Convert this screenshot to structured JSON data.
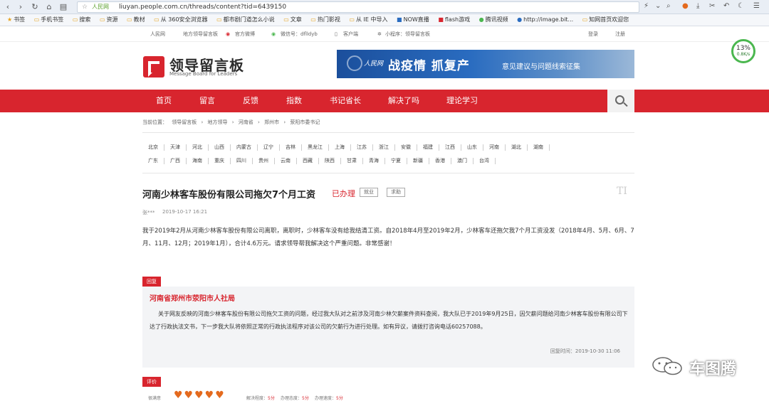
{
  "browser": {
    "url": "liuyan.people.com.cn/threads/content?tid=6439150",
    "secure_label": "人民网",
    "bookmarks": [
      "书签",
      "手机书签",
      "搜索",
      "资源",
      "教材",
      "从 360安全浏览器",
      "都市剧门道怎么小说",
      "文章",
      "热门影视",
      "从 IE 中导入",
      "NOW直播",
      "flash游戏",
      "腾讯视频",
      "http://image.bit...",
      "知网首页欢迎您"
    ]
  },
  "topstrip": {
    "site": "人民网",
    "board": "地方领导留言板",
    "weibo": "官方微博",
    "wechat": "微信号：dflldyb",
    "app": "客户端",
    "mini": "小程序：领导留言板",
    "login": "登录",
    "register": "注册"
  },
  "logo": {
    "title": "领导留言板",
    "subtitle": "Message Board for Leaders"
  },
  "banner": {
    "brand": "人民网",
    "headline": "战疫情 抓复产",
    "sub": "意见建议与问题线索征集"
  },
  "speed": {
    "value": "13%",
    "sub": "0.8K/s"
  },
  "nav": [
    "首页",
    "留言",
    "反馈",
    "指数",
    "书记省长",
    "解决了吗",
    "理论学习"
  ],
  "breadcrumb": [
    "当前位置：",
    "领导留言板",
    "›",
    "地方领导",
    "›",
    "河南省",
    "›",
    "郑州市",
    "›",
    "荥阳市委书记"
  ],
  "provinces_row1": [
    "北京",
    "天津",
    "河北",
    "山西",
    "内蒙古",
    "辽宁",
    "吉林",
    "黑龙江",
    "上海",
    "江苏",
    "浙江",
    "安徽",
    "福建",
    "江西",
    "山东",
    "河南",
    "湖北",
    "湖南"
  ],
  "provinces_row2": [
    "广东",
    "广西",
    "海南",
    "重庆",
    "四川",
    "贵州",
    "云南",
    "西藏",
    "陕西",
    "甘肃",
    "青海",
    "宁夏",
    "新疆",
    "香港",
    "澳门",
    "台湾"
  ],
  "post": {
    "title": "河南少林客车股份有限公司拖欠7个月工资",
    "status": "已办理",
    "tags": [
      "就业",
      "求助"
    ],
    "author": "张***",
    "time": "2019-10-17 16:21",
    "body": "我于2019年2月从河南少林客车股份有限公司离职，离职时，少林客车没有给我结清工资。自2018年4月至2019年2月，少林客车还拖欠我7个月工资没发（2018年4月、5月、6月、7月、11月、12月；2019年1月），合计4.6万元。请求领导帮我解决这个严重问题。非常感谢！"
  },
  "reply": {
    "label": "回复",
    "org": "河南省郑州市荥阳市人社局",
    "text": "关于网友反映的河南少林客车股份有限公司拖欠工资的问题，经过我大队对之前涉及河南少林欠薪案件资料查阅，我大队已于2019年9月25日，因欠薪问题给河南少林客车股份有限公司下达了行政执法文书，下一步我大队将依照正常的行政执法程序对该公司的欠薪行为进行处理。如有异议，请拨打咨询电话60257088。",
    "time": "回复时间：2019-10-30 11:06"
  },
  "evaluation": {
    "label": "评价",
    "satisfaction": "很满意",
    "items": [
      {
        "name": "解决程度：",
        "score": "5分"
      },
      {
        "name": "办理态度：",
        "score": "5分"
      },
      {
        "name": "办理速度：",
        "score": "5分"
      }
    ]
  },
  "watermark": {
    "text": "车图腾"
  }
}
